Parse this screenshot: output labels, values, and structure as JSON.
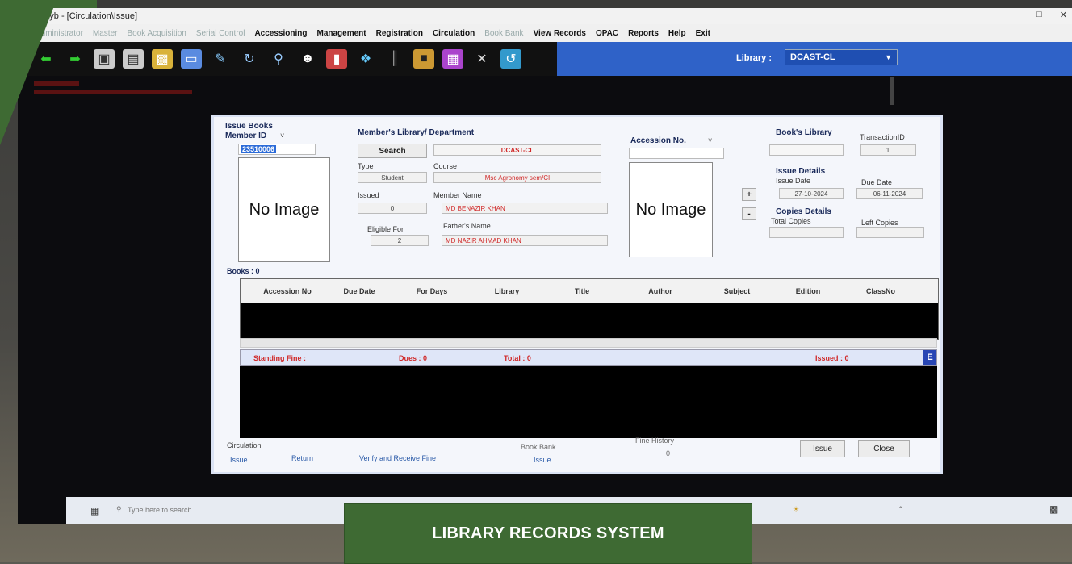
{
  "window": {
    "title": "LibCyb - [Circulation\\Issue]"
  },
  "menu": {
    "items": [
      {
        "label": "Administrator",
        "enabled": false
      },
      {
        "label": "Master",
        "enabled": false
      },
      {
        "label": "Book Acquisition",
        "enabled": false
      },
      {
        "label": "Serial Control",
        "enabled": false
      },
      {
        "label": "Accessioning",
        "enabled": true
      },
      {
        "label": "Management",
        "enabled": true
      },
      {
        "label": "Registration",
        "enabled": true
      },
      {
        "label": "Circulation",
        "enabled": true
      },
      {
        "label": "Book Bank",
        "enabled": false
      },
      {
        "label": "View Records",
        "enabled": true
      },
      {
        "label": "OPAC",
        "enabled": true
      },
      {
        "label": "Reports",
        "enabled": true
      },
      {
        "label": "Help",
        "enabled": true
      },
      {
        "label": "Exit",
        "enabled": true
      }
    ]
  },
  "library": {
    "label": "Library :",
    "value": "DCAST-CL"
  },
  "dialog": {
    "title": "Issue Books",
    "member_id_label": "Member ID",
    "member_id_value": "23510006",
    "no_image": "No Image",
    "members_library_label": "Member's Library/ Department",
    "search_button": "Search",
    "library_value": "DCAST-CL",
    "type_label": "Type",
    "type_value": "Student",
    "course_label": "Course",
    "course_value": "Msc Agronomy sem/CI",
    "issued_label": "Issued",
    "issued_value": "0",
    "member_name_label": "Member Name",
    "member_name_value": "MD BENAZIR KHAN",
    "eligible_label": "Eligible For",
    "eligible_value": "2",
    "father_name_label": "Father's Name",
    "father_name_value": "MD NAZIR AHMAD KHAN",
    "accession_label": "Accession No.",
    "plus": "+",
    "minus": "-",
    "books_library_label": "Book's Library",
    "transaction_label": "TransactionID",
    "transaction_value": "1",
    "issue_details_label": "Issue Details",
    "issue_date_label": "Issue Date",
    "issue_date_value": "27-10-2024",
    "due_date_label": "Due Date",
    "due_date_value": "06-11-2024",
    "copies_details_label": "Copies Details",
    "total_copies_label": "Total Copies",
    "left_copies_label": "Left Copies",
    "books_count": "Books : 0",
    "columns": [
      "Accession No",
      "Due Date",
      "For Days",
      "Library",
      "Title",
      "Author",
      "Subject",
      "Edition",
      "ClassNo"
    ],
    "fine_label": "Standing Fine :",
    "dues_label": "Dues : 0",
    "total_label": "Total : 0",
    "issued_count_label": "Issued : 0",
    "e_button": "E",
    "circulation_label": "Circulation",
    "circ_issue_link": "Issue",
    "circ_return_link": "Return",
    "verify_link": "Verify and Receive Fine",
    "book_bank_label": "Book Bank",
    "book_bank_issue_link": "Issue",
    "fine_history_label": "Fine History",
    "fine_history_value": "0",
    "issue_button": "Issue",
    "close_button": "Close"
  },
  "taskbar": {
    "search_placeholder": "Type here to search"
  },
  "banner": {
    "text": "LIBRARY RECORDS SYSTEM"
  },
  "colors": {
    "brand_green": "#3e6a33",
    "lib_band": "#2f62c8",
    "red_text": "#d02828"
  }
}
